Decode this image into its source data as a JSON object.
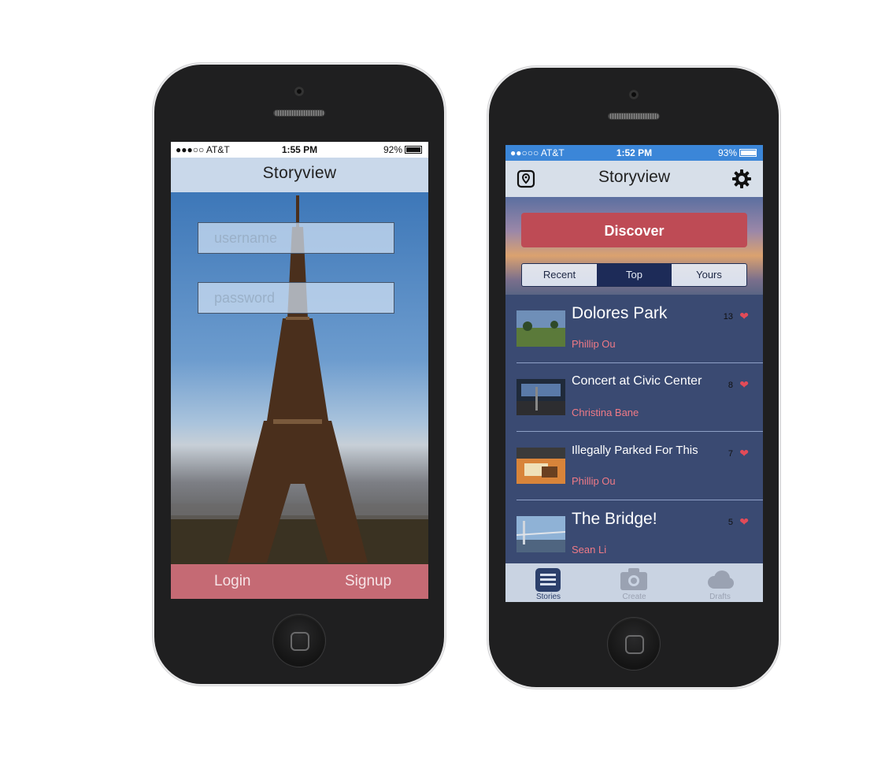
{
  "login_screen": {
    "status": {
      "carrier": "●●●○○ AT&T",
      "time": "1:55 PM",
      "battery": "92%",
      "battery_level": 0.92
    },
    "title": "Storyview",
    "username_placeholder": "username",
    "password_placeholder": "password",
    "login_label": "Login",
    "signup_label": "Signup"
  },
  "feed_screen": {
    "status": {
      "carrier": "●●○○○ AT&T",
      "time": "1:52 PM",
      "battery": "93%",
      "battery_level": 0.93
    },
    "title": "Storyview",
    "map_icon": "map-pin-icon",
    "settings_icon": "gear-icon",
    "discover_label": "Discover",
    "segments": [
      "Recent",
      "Top",
      "Yours"
    ],
    "selected_segment": "Top",
    "stories": [
      {
        "title": "Dolores Park",
        "author": "Phillip Ou",
        "likes": "13"
      },
      {
        "title": "Concert at Civic Center",
        "author": "Christina Bane",
        "likes": "8"
      },
      {
        "title": "Illegally Parked For This",
        "author": "Phillip Ou",
        "likes": "7"
      },
      {
        "title": "The Bridge!",
        "author": "Sean Li",
        "likes": "5"
      }
    ],
    "tabs": [
      {
        "label": "Stories",
        "icon": "list-icon"
      },
      {
        "label": "Create",
        "icon": "camera-icon"
      },
      {
        "label": "Drafts",
        "icon": "cloud-icon"
      }
    ],
    "active_tab": "Stories"
  },
  "colors": {
    "accent_red": "#be4b55",
    "navy": "#1d2b58",
    "list_bg": "#3a4a72",
    "author_pink": "#ef7a86"
  }
}
